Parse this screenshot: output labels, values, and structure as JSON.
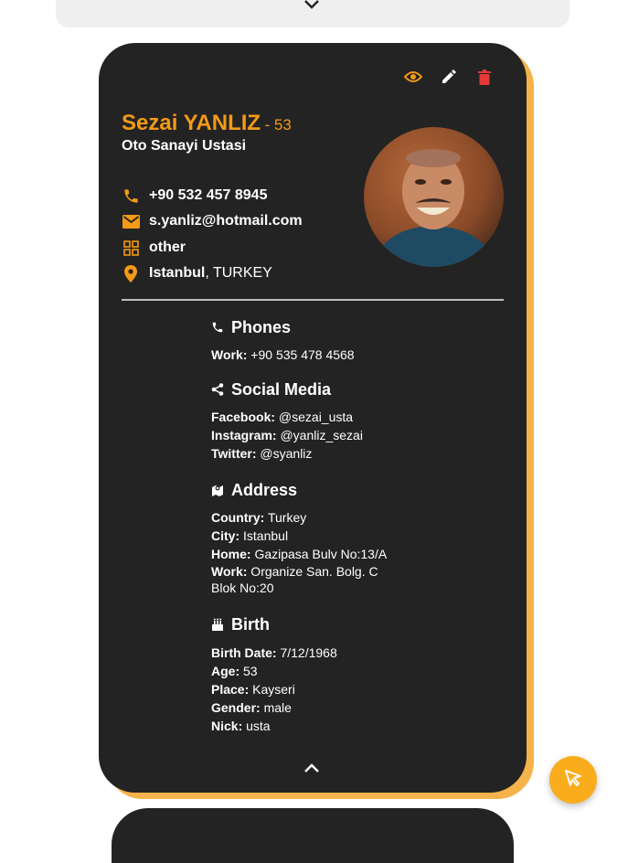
{
  "colors": {
    "accent": "#f39a16",
    "card_bg": "#232323",
    "shadow": "#f6b34b",
    "delete": "#e53935",
    "fab": "#f9ad1d"
  },
  "contact": {
    "name": "Sezai YANLIZ",
    "age_suffix": "- 53",
    "title": "Oto Sanayi Ustasi",
    "phone": "+90 532 457 8945",
    "email": "s.yanliz@hotmail.com",
    "category": "other",
    "city": "Istanbul",
    "country": ", TURKEY"
  },
  "sections": {
    "phones": {
      "heading": "Phones",
      "rows": [
        {
          "label": "Work:",
          "value": " +90 535 478 4568"
        }
      ]
    },
    "social": {
      "heading": "Social Media",
      "rows": [
        {
          "label": "Facebook:",
          "value": " @sezai_usta"
        },
        {
          "label": "Instagram:",
          "value": " @yanliz_sezai"
        },
        {
          "label": "Twitter:",
          "value": " @syanliz"
        }
      ]
    },
    "address": {
      "heading": "Address",
      "rows": [
        {
          "label": "Country:",
          "value": " Turkey"
        },
        {
          "label": "City:",
          "value": " Istanbul"
        },
        {
          "label": "Home:",
          "value": " Gazipasa Bulv No:13/A"
        },
        {
          "label": "Work:",
          "value": " Organize San. Bolg. C"
        },
        {
          "label": "",
          "value": "Blok No:20"
        }
      ]
    },
    "birth": {
      "heading": "Birth",
      "rows": [
        {
          "label": "Birth Date:",
          "value": " 7/12/1968"
        },
        {
          "label": "Age:",
          "value": " 53"
        },
        {
          "label": "Place:",
          "value": " Kayseri"
        },
        {
          "label": "Gender:",
          "value": " male"
        },
        {
          "label": "Nick:",
          "value": " usta"
        }
      ]
    }
  },
  "icons": [
    "chevron-down-icon",
    "eye-icon",
    "pencil-icon",
    "trash-icon",
    "phone-icon",
    "email-icon",
    "category-icon",
    "location-pin-icon",
    "phone-icon",
    "share-icon",
    "map-icon",
    "cake-icon",
    "chevron-up-icon",
    "cursor-pointer-icon"
  ]
}
